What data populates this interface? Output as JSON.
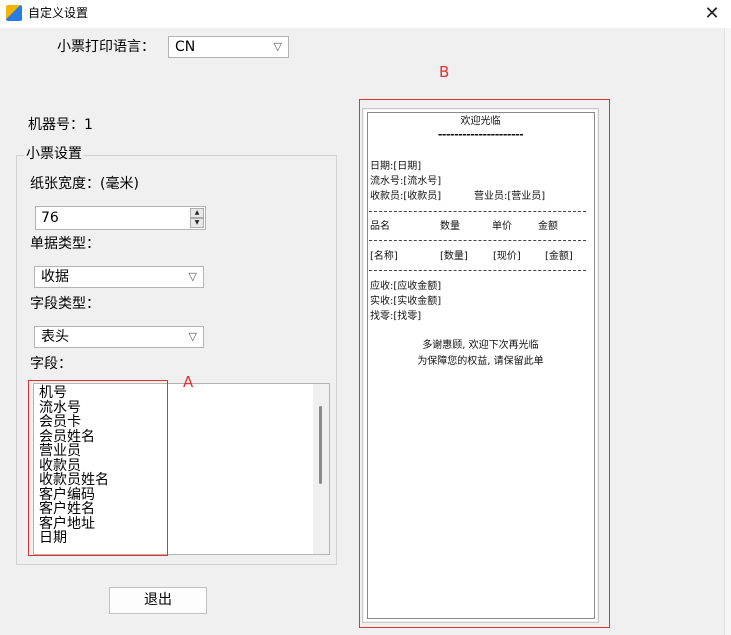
{
  "window": {
    "title": "自定义设置",
    "close_glyph": "✕"
  },
  "print_language": {
    "label": "小票打印语言：",
    "selected": "CN"
  },
  "machine": {
    "label": "机器号：",
    "value": "1"
  },
  "ticket_settings": {
    "group_title": "小票设置",
    "paper_width_label": "纸张宽度：(毫米)",
    "paper_width_value": "76",
    "doc_type_label": "单据类型：",
    "doc_type_selected": "收据",
    "field_type_label": "字段类型：",
    "field_type_selected": "表头",
    "fields_label": "字段：",
    "fields": [
      "机号",
      "流水号",
      "会员卡",
      "会员姓名",
      "营业员",
      "收款员",
      "收款员姓名",
      "客户编码",
      "客户姓名",
      "客户地址",
      "日期"
    ]
  },
  "exit_button": "退出",
  "annotations": {
    "a": "A",
    "b": "B",
    "color": "#e03030"
  },
  "preview": {
    "header": "欢迎光临",
    "header_rule": "---------------------",
    "date": "日期:[日期]",
    "serial": "流水号:[流水号]",
    "cashier": "收款员:[收款员]",
    "clerk": "营业员:[营业员]",
    "col_name": "品名",
    "col_qty": "数量",
    "col_price": "单价",
    "col_amount": "金额",
    "item_name": "[名称]",
    "item_qty": "[数量]",
    "item_price": "[现价]",
    "item_amount": "[金额]",
    "receivable": "应收:[应收金额]",
    "received": "实收:[实收金额]",
    "change": "找零:[找零]",
    "footer1": "多谢惠顾, 欢迎下次再光临",
    "footer2": "为保障您的权益, 请保留此单"
  }
}
